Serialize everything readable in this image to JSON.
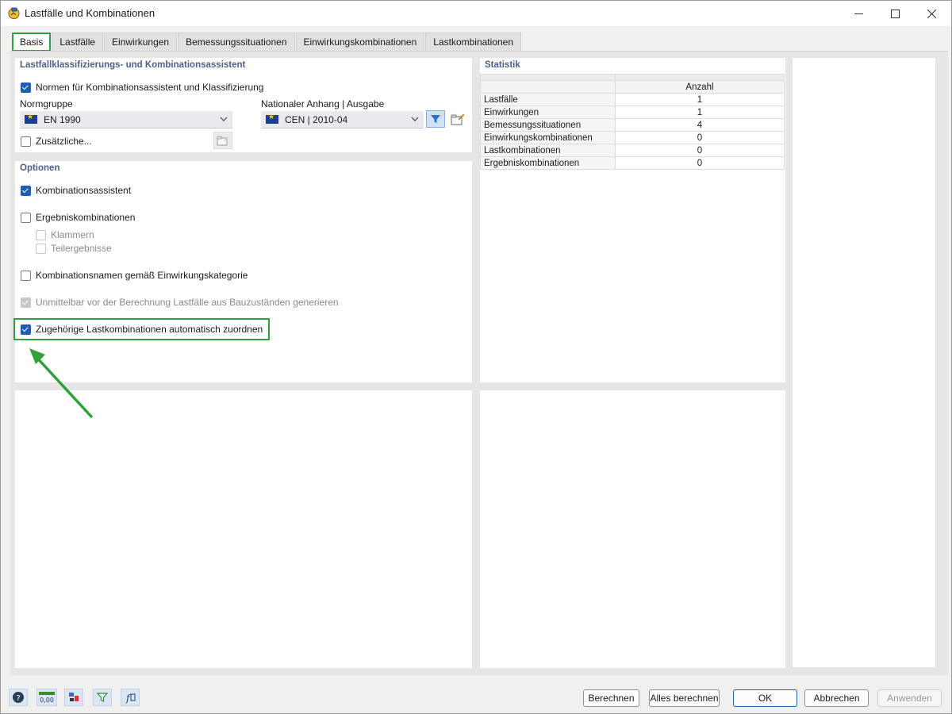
{
  "window": {
    "title": "Lastfälle und Kombinationen"
  },
  "tabs": [
    {
      "label": "Basis"
    },
    {
      "label": "Lastfälle"
    },
    {
      "label": "Einwirkungen"
    },
    {
      "label": "Bemessungssituationen"
    },
    {
      "label": "Einwirkungskombinationen"
    },
    {
      "label": "Lastkombinationen"
    }
  ],
  "classification": {
    "title": "Lastfallklassifizierungs- und Kombinationsassistent",
    "norms_checkbox": "Normen für Kombinationsassistent und Klassifizierung",
    "norm_group_label": "Normgruppe",
    "norm_group_value": "EN 1990",
    "national_annex_label": "Nationaler Anhang | Ausgabe",
    "national_annex_value": "CEN | 2010-04",
    "additional_checkbox": "Zusätzliche..."
  },
  "options": {
    "title": "Optionen",
    "combination_wizard": "Kombinationsassistent",
    "result_combinations": "Ergebniskombinationen",
    "brackets": "Klammern",
    "partial_results": "Teilergebnisse",
    "combination_names": "Kombinationsnamen gemäß Einwirkungskategorie",
    "construction_stages": "Unmittelbar vor der Berechnung Lastfälle aus Bauzuständen generieren",
    "auto_assign": "Zugehörige Lastkombinationen automatisch zuordnen"
  },
  "statistics": {
    "title": "Statistik",
    "column_header": "Anzahl",
    "rows": [
      {
        "name": "Lastfälle",
        "count": "1"
      },
      {
        "name": "Einwirkungen",
        "count": "1"
      },
      {
        "name": "Bemessungssituationen",
        "count": "4"
      },
      {
        "name": "Einwirkungskombinationen",
        "count": "0"
      },
      {
        "name": "Lastkombinationen",
        "count": "0"
      },
      {
        "name": "Ergebniskombinationen",
        "count": "0"
      }
    ]
  },
  "buttons": {
    "calculate": "Berechnen",
    "calculate_all": "Alles berechnen",
    "ok": "OK",
    "cancel": "Abbrechen",
    "apply": "Anwenden"
  },
  "colors": {
    "highlight": "#2ea03c",
    "accent": "#1f5db3",
    "section_title": "#4c6089"
  }
}
